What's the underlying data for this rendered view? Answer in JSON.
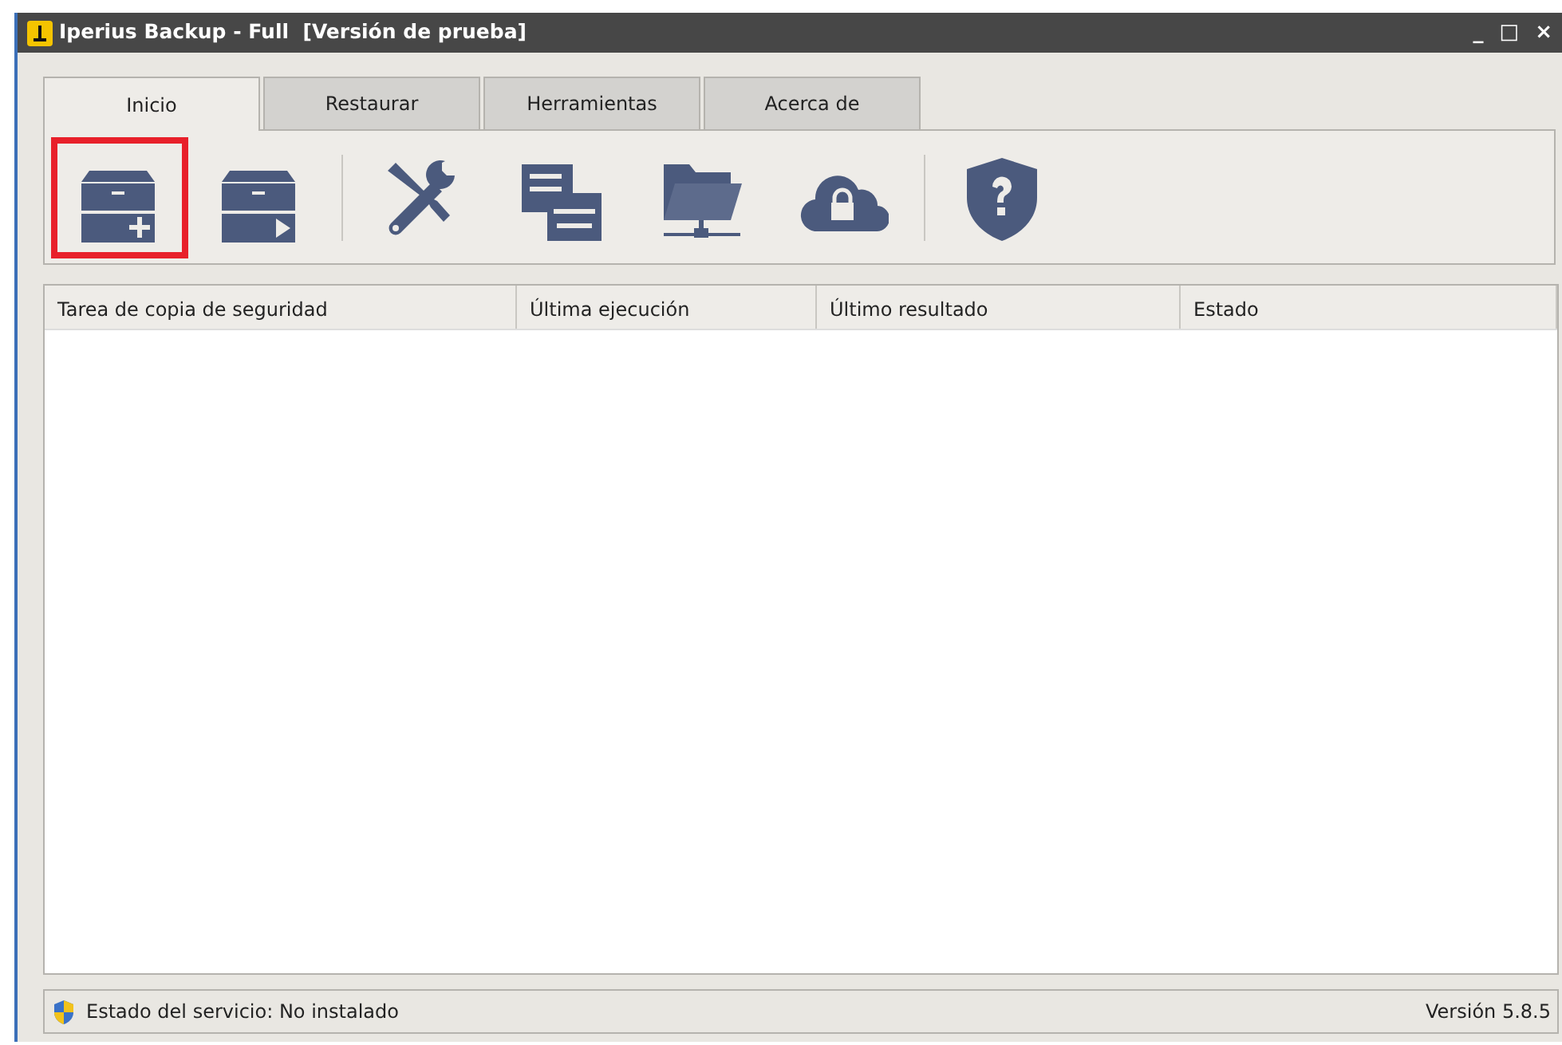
{
  "window": {
    "title": "Iperius Backup - Full  [Versión de prueba]",
    "controls": [
      "_",
      "□",
      "×"
    ]
  },
  "tabs": [
    {
      "label": "Inicio",
      "selected": true
    },
    {
      "label": "Restaurar",
      "selected": false
    },
    {
      "label": "Herramientas",
      "selected": false
    },
    {
      "label": "Acerca de",
      "selected": false
    }
  ],
  "toolbar": {
    "groups": [
      [
        {
          "kind": "box-plus",
          "selected": true
        },
        {
          "kind": "box-play",
          "selected": false
        }
      ],
      [
        {
          "kind": "tools",
          "selected": false
        },
        {
          "kind": "list",
          "selected": false
        },
        {
          "kind": "network-folder",
          "selected": false
        },
        {
          "kind": "cloud-lock",
          "selected": false
        }
      ],
      [
        {
          "kind": "shield-help",
          "selected": false
        }
      ]
    ]
  },
  "table": {
    "columns": [
      "Tarea de copia de seguridad",
      "Última ejecución",
      "Último resultado",
      "Estado"
    ]
  },
  "status_bar": {
    "left": "Estado del servicio: No instalado",
    "right": "Versión 5.8.5"
  }
}
